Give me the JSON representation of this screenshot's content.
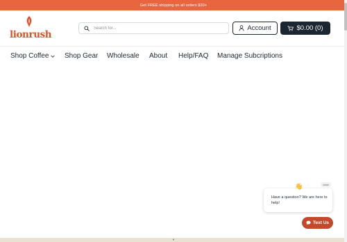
{
  "promo": {
    "text": "Get FREE shipping on all orders $30+"
  },
  "brand": {
    "logo_text": "lionrush",
    "accent": "#e0502c"
  },
  "search": {
    "placeholder": "Search for..."
  },
  "account": {
    "label": "Account",
    "icon": "user-icon"
  },
  "cart": {
    "label": "$0.00 (0)",
    "icon": "cart-icon"
  },
  "nav": {
    "items": [
      {
        "label": "Shop Coffee",
        "has_dropdown": true
      },
      {
        "label": "Shop Gear"
      },
      {
        "label": "Wholesale"
      },
      {
        "label": "About"
      },
      {
        "label": "Help/FAQ"
      },
      {
        "label": "Manage Subcriptions"
      }
    ]
  },
  "chat": {
    "message": "Have a question? We are here to help!",
    "close_label": "close",
    "wave_icon": "waving-hand-icon",
    "button_label": "Text Us",
    "button_color": "#c24a2a"
  },
  "colors": {
    "promo_bar": "#e8653e",
    "dark": "#1c2532",
    "footer_strip": "#e9e1d2"
  }
}
